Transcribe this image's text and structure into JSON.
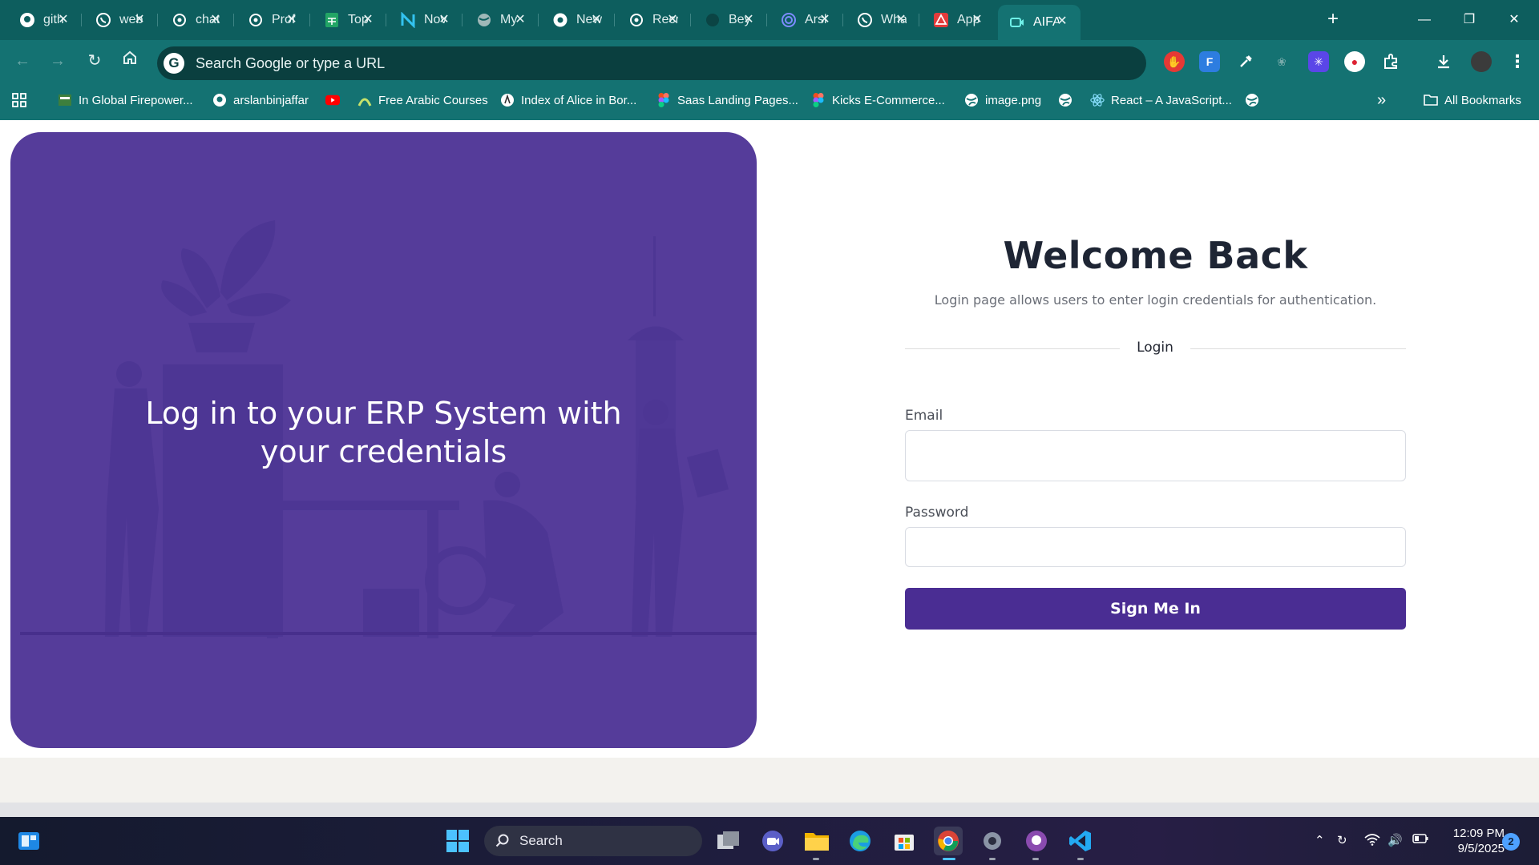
{
  "browser": {
    "tabs": [
      {
        "label": "gith",
        "icon": "github-icon"
      },
      {
        "label": "web",
        "icon": "whatsapp-icon"
      },
      {
        "label": "chat",
        "icon": "openai-icon"
      },
      {
        "label": "Prof",
        "icon": "openai-icon"
      },
      {
        "label": "Top",
        "icon": "sheets-icon"
      },
      {
        "label": "Nov",
        "icon": "notion-n-icon"
      },
      {
        "label": "My",
        "icon": "globe-icon"
      },
      {
        "label": "New",
        "icon": "chrome-icon"
      },
      {
        "label": "Recr",
        "icon": "openai-icon"
      },
      {
        "label": "Bey",
        "icon": "dark-circle-icon"
      },
      {
        "label": "Arsl",
        "icon": "fingerprint-icon"
      },
      {
        "label": "Wha",
        "icon": "whatsapp-icon"
      },
      {
        "label": "App",
        "icon": "warning-red-icon"
      },
      {
        "label": "AIFA",
        "icon": "app-teal-icon",
        "active": true
      }
    ],
    "close_glyph": "✕",
    "new_tab_glyph": "+",
    "omnibox_placeholder": "Search Google or type a URL",
    "bookmarks": [
      {
        "label": "In Global Firepower..."
      },
      {
        "label": "arslanbinjaffar"
      },
      {
        "label": ""
      },
      {
        "label": "Free Arabic Courses"
      },
      {
        "label": "Index of Alice in Bor..."
      },
      {
        "label": "Saas Landing Pages..."
      },
      {
        "label": "Kicks E-Commerce..."
      },
      {
        "label": "image.png"
      },
      {
        "label": ""
      },
      {
        "label": "React – A JavaScript..."
      },
      {
        "label": ""
      }
    ],
    "all_bookmarks": "All Bookmarks",
    "more_bookmarks": "»"
  },
  "page": {
    "hero_title": "Log in to your ERP System with your credentials",
    "welcome_title": "Welcome Back",
    "subtitle": "Login page allows users to enter login credentials for authentication.",
    "divider_label": "Login",
    "email_label": "Email",
    "email_value": "",
    "password_label": "Password",
    "password_value": "",
    "signin_label": "Sign Me In",
    "colors": {
      "hero": "#553c9a",
      "button": "#4a2d93",
      "browser": "#147272"
    }
  },
  "taskbar": {
    "search_label": "Search",
    "time": "12:09 PM",
    "date": "9/5/2025",
    "notifications": "2"
  }
}
